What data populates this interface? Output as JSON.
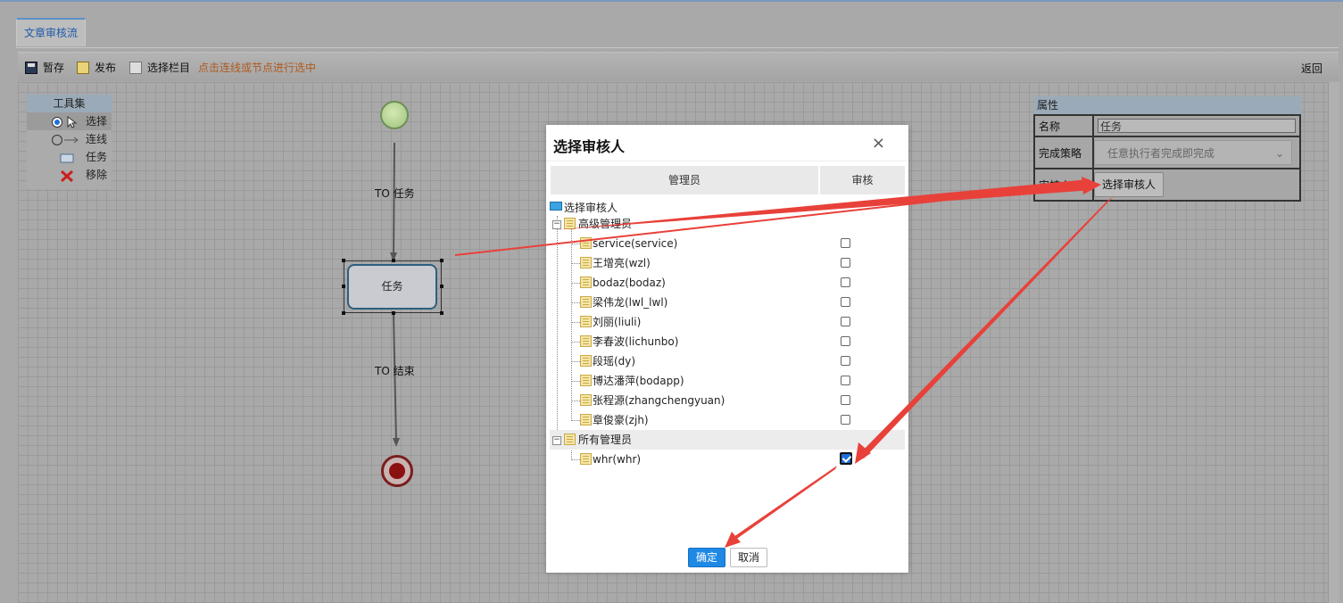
{
  "tab": {
    "label": "文章审核流"
  },
  "toolbar": {
    "save_label": "暂存",
    "publish_label": "发布",
    "select_column_label": "选择栏目",
    "hint": "点击连线或节点进行选中",
    "back_label": "返回"
  },
  "toolset": {
    "title": "工具集",
    "items": [
      {
        "label": "选择",
        "icon": "radio-pointer-icon"
      },
      {
        "label": "连线",
        "icon": "connector-icon"
      },
      {
        "label": "任务",
        "icon": "task-rect-icon"
      },
      {
        "label": "移除",
        "icon": "red-x-icon"
      }
    ]
  },
  "canvas": {
    "edge1_label": "TO 任务",
    "edge2_label": "TO 结束",
    "task_label": "任务"
  },
  "properties": {
    "title": "属性",
    "name_label": "名称",
    "name_value": "任务",
    "strategy_label": "完成策略",
    "strategy_value": "任意执行者完成即完成",
    "reviewer_label": "审核人",
    "reviewer_button": "选择审核人"
  },
  "dialog": {
    "title": "选择审核人",
    "close_glyph": "×",
    "col_admin": "管理员",
    "col_review": "审核",
    "root": "选择审核人",
    "group1": {
      "name": "高级管理员",
      "users": [
        {
          "name": "service(service)",
          "checked": false
        },
        {
          "name": "王增亮(wzl)",
          "checked": false
        },
        {
          "name": "bodaz(bodaz)",
          "checked": false
        },
        {
          "name": "梁伟龙(lwl_lwl)",
          "checked": false
        },
        {
          "name": "刘丽(liuli)",
          "checked": false
        },
        {
          "name": "李春波(lichunbo)",
          "checked": false
        },
        {
          "name": "段瑶(dy)",
          "checked": false
        },
        {
          "name": "博达潘萍(bodapp)",
          "checked": false
        },
        {
          "name": "张程源(zhangchengyuan)",
          "checked": false
        },
        {
          "name": "章俊豪(zjh)",
          "checked": false
        }
      ]
    },
    "group2": {
      "name": "所有管理员",
      "users": [
        {
          "name": "whr(whr)",
          "checked": true
        }
      ]
    },
    "ok_label": "确定",
    "cancel_label": "取消"
  },
  "colors": {
    "accent_blue": "#1e88e5",
    "annotation_red": "#e8413a",
    "hint_orange": "#b05a1e"
  }
}
